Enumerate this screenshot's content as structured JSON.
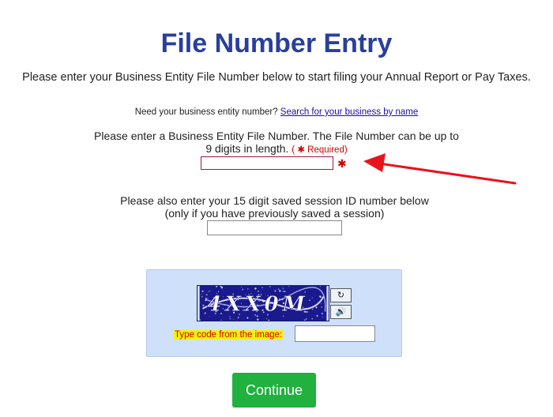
{
  "header": {
    "title": "File Number Entry",
    "intro": "Please enter your Business Entity File Number below to start filing your Annual Report or Pay Taxes."
  },
  "lookup": {
    "prompt": "Need your business entity number?",
    "link_text": "Search for your business by name"
  },
  "file_number": {
    "instruction_line1": "Please enter a Business Entity File Number. The File Number can be up to",
    "instruction_line2": "9 digits in length.",
    "required_open": "(",
    "required_star": "✱",
    "required_text": "Required)",
    "value": "",
    "field_star": "✱"
  },
  "session": {
    "instruction_line1": "Please also enter your 15 digit saved session ID number below",
    "instruction_line2": "(only if you have previously saved a session)",
    "value": ""
  },
  "captcha": {
    "image_text": "4XX0M",
    "refresh_glyph": "↻",
    "audio_glyph": "🔊",
    "label": "Type code from the image:",
    "value": ""
  },
  "actions": {
    "continue_label": "Continue"
  },
  "colors": {
    "title": "#2a3f9a",
    "required": "#d40000",
    "arrow": "#e8141a",
    "captcha_panel": "#cfe0fb",
    "captcha_label_bg": "#f6f20a",
    "continue_bg": "#20b13f"
  }
}
